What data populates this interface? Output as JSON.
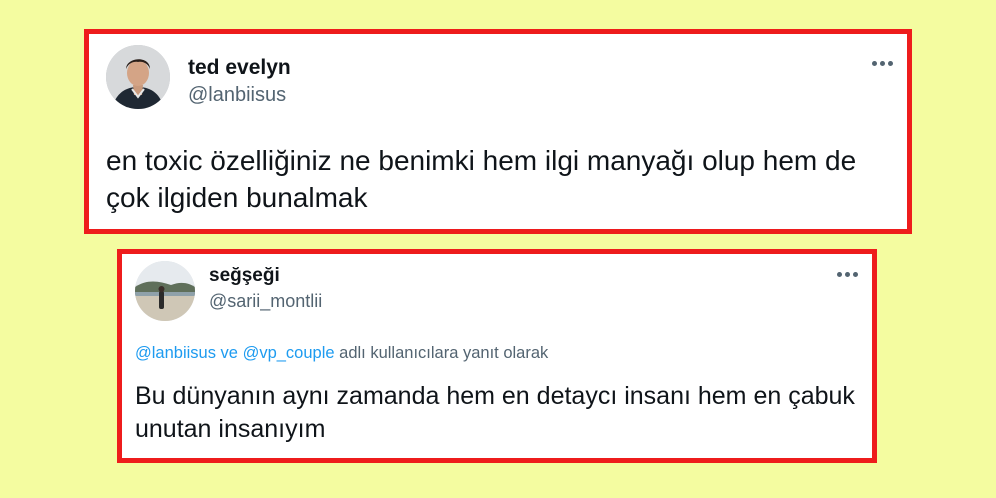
{
  "tweets": [
    {
      "display_name": "ted evelyn",
      "handle": "@lanbiisus",
      "text": "en toxic özelliğiniz ne benimki hem ilgi manyağı olup hem de çok ilgiden bunalmak",
      "avatar_icon": "profile-photo-man",
      "menu_icon": "more-options-icon"
    },
    {
      "display_name": "seğşeği",
      "handle": "@sarii_montlii",
      "reply_to": {
        "mention_1": "@lanbiisus",
        "connector": "ve",
        "mention_2": "@vp_couple",
        "suffix": "adlı kullanıcılara yanıt olarak"
      },
      "text": "Bu dünyanın aynı zamanda hem en detaycı insanı hem en çabuk unutan insanıyım",
      "avatar_icon": "profile-photo-landscape",
      "menu_icon": "more-options-icon"
    }
  ],
  "colors": {
    "background": "#f4fca0",
    "card_border": "#ee1c1c",
    "card_background": "#ffffff",
    "text_primary": "#0f1419",
    "text_secondary": "#536471",
    "mention": "#1d9bf0"
  }
}
